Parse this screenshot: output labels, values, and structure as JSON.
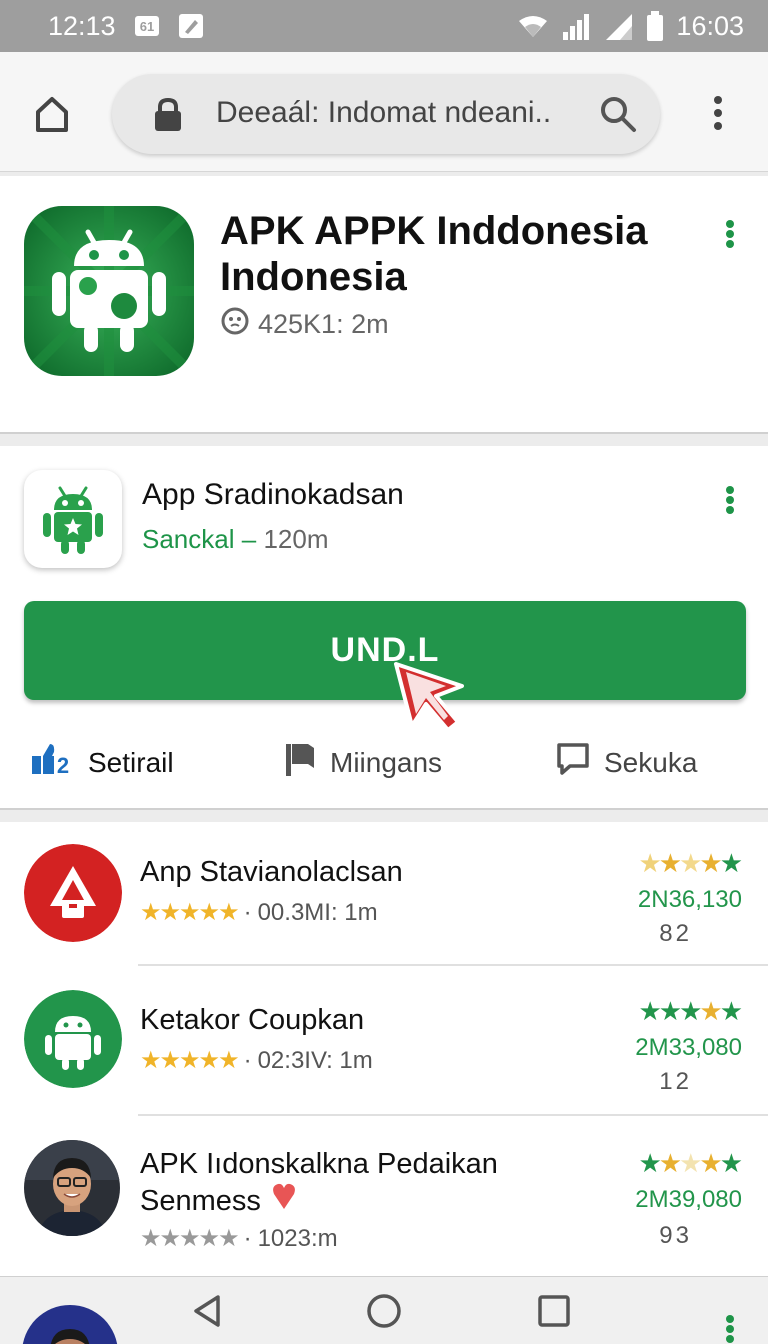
{
  "status_bar": {
    "time_left": "12:13",
    "notif_badge": "61",
    "time_right": "16:03"
  },
  "browser": {
    "url_text": "Deeaál: Indomat ndeani.."
  },
  "hero": {
    "title": "APK APPK Inddonesia Indonesia",
    "meta": "425K1: 2m"
  },
  "app": {
    "name": "App Sradinokadsan",
    "category": "Sanckal",
    "dash": "–",
    "size": "120m",
    "install_label": "UND.L",
    "actions": [
      {
        "label": "Setirail"
      },
      {
        "label": "Miingans"
      },
      {
        "label": "Sekuka"
      }
    ]
  },
  "list": [
    {
      "title": "Anp Stavianolaclsan",
      "meta": "00.3MI: 1m",
      "count": "2N36,130",
      "num": "82"
    },
    {
      "title": "Ketakor Coupkan",
      "meta": "02:3IV: 1m",
      "count": "2M33,080",
      "num": "12"
    },
    {
      "title": "APK Iıdonskalkna Pedaikan",
      "subtitle": "Senmess",
      "meta": "1023:m",
      "count": "2M39,080",
      "num": "93"
    }
  ],
  "colors": {
    "accent_green": "#22954b",
    "star_gold": "#f0b429",
    "status_bar": "#9e9e9e"
  }
}
